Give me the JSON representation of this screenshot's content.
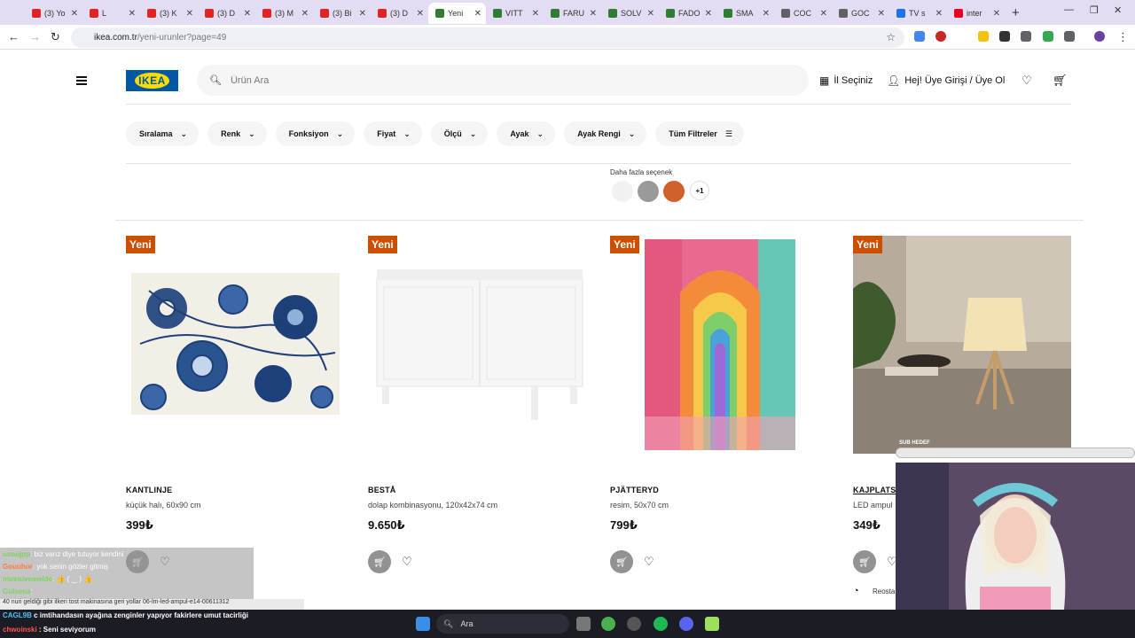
{
  "browser": {
    "tabs": [
      {
        "label": "(3) Yo",
        "color": "#e02424"
      },
      {
        "label": "L",
        "color": "#e02424"
      },
      {
        "label": "(3) K",
        "color": "#e02424"
      },
      {
        "label": "(3) D",
        "color": "#e02424"
      },
      {
        "label": "(3) M",
        "color": "#e02424"
      },
      {
        "label": "(3) Bi",
        "color": "#e02424"
      },
      {
        "label": "(3) D",
        "color": "#e02424"
      },
      {
        "label": "Yeni",
        "color": "#2e7d32"
      },
      {
        "label": "VITT",
        "color": "#2e7d32"
      },
      {
        "label": "FARU",
        "color": "#2e7d32"
      },
      {
        "label": "SOLV",
        "color": "#2e7d32"
      },
      {
        "label": "FADO",
        "color": "#2e7d32"
      },
      {
        "label": "SMA",
        "color": "#2e7d32"
      },
      {
        "label": "COC",
        "color": "#5f6368"
      },
      {
        "label": "GOC",
        "color": "#5f6368"
      },
      {
        "label": "TV s",
        "color": "#1a73e8"
      },
      {
        "label": "inter",
        "color": "#e60023"
      }
    ],
    "active_tab": 7,
    "url_host": "ikea.com.tr",
    "url_path": "/yeni-urunler?page=49"
  },
  "header": {
    "logo_text": "IKEA",
    "search_placeholder": "Ürün Ara",
    "store_label": "İl Seçiniz",
    "account_label": "Hej! Üye Girişi / Üye Ol"
  },
  "filters": [
    "Sıralama",
    "Renk",
    "Fonksiyon",
    "Fiyat",
    "Ölçü",
    "Ayak",
    "Ayak Rengi"
  ],
  "all_filters_label": "Tüm Filtreler",
  "more_options": {
    "label": "Daha fazla seçenek",
    "plus": "+1",
    "swatches": [
      "#f1f1f1",
      "#9a9a9a",
      "#d2602c"
    ]
  },
  "products": [
    {
      "badge": "Yeni",
      "name": "KANTLINJE",
      "desc": "küçük halı, 60x90 cm",
      "price": "399₺"
    },
    {
      "badge": "Yeni",
      "name": "BESTÅ",
      "desc": "dolap kombinasyonu, 120x42x74 cm",
      "price": "9.650₺"
    },
    {
      "badge": "Yeni",
      "name": "PJÄTTERYD",
      "desc": "resim, 50x70 cm",
      "price": "799₺"
    },
    {
      "badge": "Yeni",
      "name": "KAJPLATS",
      "desc": "LED ampul",
      "price": "349₺"
    }
  ],
  "stream": {
    "sub_label": "SUB HEDEF",
    "chat": [
      {
        "user": "usoojpp",
        "msg": ": biz varız diye tutuyor kendini"
      },
      {
        "user": "Gouuhor",
        "msg": ": yok senin gözler gitmiş"
      },
      {
        "user": "mustuvemelde",
        "msg": ": 👍 ( ‿ ) 👍"
      },
      {
        "user": "Gulsena",
        "msg": ":"
      }
    ],
    "ticker": "40 nuri geldiği gibi ilkeri tost makinasına geri yollar",
    "ticker_tail": "06-lm-led-ampul-e14-00611312",
    "chat2": [
      {
        "user": "CAGL9B",
        "msg": "c imtihandasın ayağına zenginler yapıyor fakirlere umut tacirliği"
      },
      {
        "user": "chwoinski",
        "msg": ": Seni seviyorum"
      }
    ],
    "stock_label": "Reosta"
  },
  "taskbar": {
    "search_label": "Ara"
  }
}
